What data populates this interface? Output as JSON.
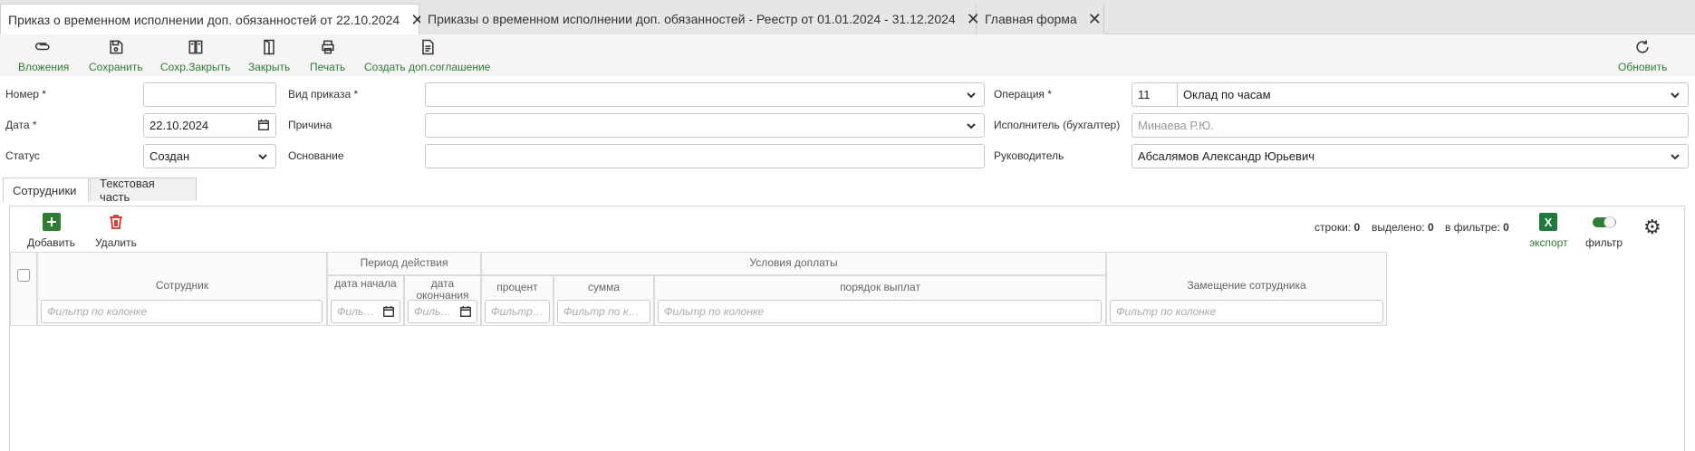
{
  "tabs": [
    {
      "label": "Приказ о временном исполнении доп. обязанностей от 22.10.2024"
    },
    {
      "label": "Приказы о временном исполнении доп. обязанностей - Реестр от 01.01.2024 - 31.12.2024"
    },
    {
      "label": "Главная форма"
    }
  ],
  "toolbar": {
    "attachments": "Вложения",
    "save": "Сохранить",
    "save_close": "Сохр.Закрыть",
    "close": "Закрыть",
    "print": "Печать",
    "create_addendum": "Создать доп.соглашение",
    "refresh": "Обновить"
  },
  "form": {
    "number": {
      "label": "Номер *",
      "value": ""
    },
    "date": {
      "label": "Дата *",
      "value": "22.10.2024"
    },
    "status": {
      "label": "Статус",
      "value": "Создан"
    },
    "order_type": {
      "label": "Вид приказа *",
      "value": ""
    },
    "reason": {
      "label": "Причина",
      "value": ""
    },
    "basis": {
      "label": "Основание",
      "value": ""
    },
    "operation": {
      "label": "Операция *",
      "code": "11",
      "value": "Оклад по часам"
    },
    "executor": {
      "label": "Исполнитель (бухгалтер)",
      "placeholder": "Минаева Р.Ю."
    },
    "manager": {
      "label": "Руководитель",
      "value": "Абсалямов Александр Юрьевич"
    }
  },
  "section_tabs": {
    "employees": "Сотрудники",
    "text_part": "Текстовая часть"
  },
  "grid": {
    "add": "Добавить",
    "delete": "Удалить",
    "rows_label": "строки:",
    "rows": "0",
    "selected_label": "выделено:",
    "selected": "0",
    "filtered_label": "в фильтре:",
    "filtered": "0",
    "export": "экспорт",
    "filter": "фильтр",
    "headers": {
      "employee": "Сотрудник",
      "period": "Период действия",
      "start_date": "дата начала",
      "end_date": "дата окончания",
      "conditions": "Условия доплаты",
      "percent": "процент",
      "amount": "сумма",
      "payment_order": "порядок выплат",
      "substitution": "Замещение сотрудника"
    },
    "filters": {
      "employee": "Фильтр по колонке",
      "start_date": "Фильтр по колонке",
      "end_date": "Фильтр по колонке",
      "percent": "Фильтр по колонке",
      "amount": "Фильтр по колонке",
      "payment_order": "Фильтр по колонке",
      "substitution": "Фильтр по колонке"
    }
  },
  "colors": {
    "accent": "#2e7d32",
    "delete": "#d32f2f",
    "excel": "#1d7a3a"
  }
}
